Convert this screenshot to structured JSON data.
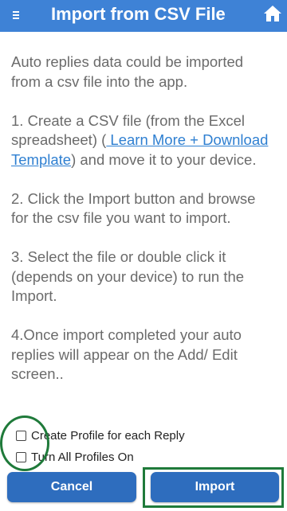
{
  "header": {
    "title": "Import from CSV File",
    "menu_icon": "menu-icon",
    "home_icon": "home-icon",
    "background_color": "#3e82d6"
  },
  "content": {
    "intro": "Auto replies data could be imported from a csv file into the app.",
    "step1_prefix": "1. Create a CSV file (from the Excel spreadsheet) (",
    "step1_link": " Learn More + Download Template",
    "step1_suffix": ") and move it to your device.",
    "step2": "2. Click the Import button and browse for the csv file you want to import.",
    "step3": "3. Select the file or double click it (depends on your device) to run the Import.",
    "step4": "4.Once import completed your auto replies will appear on the Add/ Edit screen.."
  },
  "options": {
    "create_profile_label": "Create Profile for each Reply",
    "turn_profiles_on_label": "Turn All Profiles On"
  },
  "buttons": {
    "cancel_label": "Cancel",
    "import_label": "Import"
  },
  "colors": {
    "accent": "#2e6dbe",
    "link": "#2e7fd1",
    "annotation": "#1f7a3a"
  }
}
